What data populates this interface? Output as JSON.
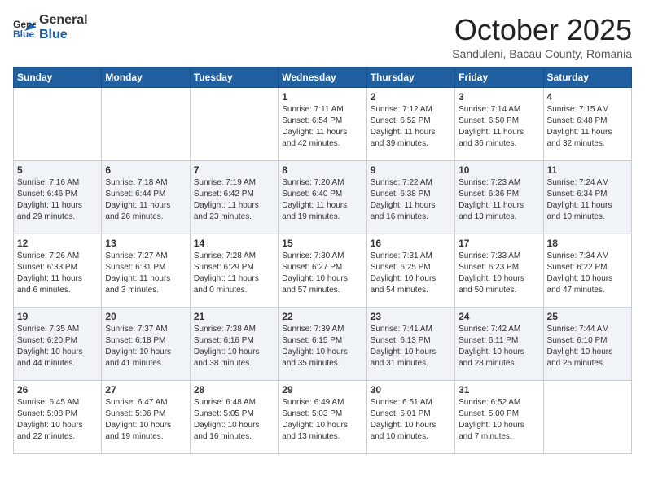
{
  "header": {
    "logo_general": "General",
    "logo_blue": "Blue",
    "month_title": "October 2025",
    "subtitle": "Sanduleni, Bacau County, Romania"
  },
  "weekdays": [
    "Sunday",
    "Monday",
    "Tuesday",
    "Wednesday",
    "Thursday",
    "Friday",
    "Saturday"
  ],
  "weeks": [
    [
      {
        "day": "",
        "info": ""
      },
      {
        "day": "",
        "info": ""
      },
      {
        "day": "",
        "info": ""
      },
      {
        "day": "1",
        "info": "Sunrise: 7:11 AM\nSunset: 6:54 PM\nDaylight: 11 hours\nand 42 minutes."
      },
      {
        "day": "2",
        "info": "Sunrise: 7:12 AM\nSunset: 6:52 PM\nDaylight: 11 hours\nand 39 minutes."
      },
      {
        "day": "3",
        "info": "Sunrise: 7:14 AM\nSunset: 6:50 PM\nDaylight: 11 hours\nand 36 minutes."
      },
      {
        "day": "4",
        "info": "Sunrise: 7:15 AM\nSunset: 6:48 PM\nDaylight: 11 hours\nand 32 minutes."
      }
    ],
    [
      {
        "day": "5",
        "info": "Sunrise: 7:16 AM\nSunset: 6:46 PM\nDaylight: 11 hours\nand 29 minutes."
      },
      {
        "day": "6",
        "info": "Sunrise: 7:18 AM\nSunset: 6:44 PM\nDaylight: 11 hours\nand 26 minutes."
      },
      {
        "day": "7",
        "info": "Sunrise: 7:19 AM\nSunset: 6:42 PM\nDaylight: 11 hours\nand 23 minutes."
      },
      {
        "day": "8",
        "info": "Sunrise: 7:20 AM\nSunset: 6:40 PM\nDaylight: 11 hours\nand 19 minutes."
      },
      {
        "day": "9",
        "info": "Sunrise: 7:22 AM\nSunset: 6:38 PM\nDaylight: 11 hours\nand 16 minutes."
      },
      {
        "day": "10",
        "info": "Sunrise: 7:23 AM\nSunset: 6:36 PM\nDaylight: 11 hours\nand 13 minutes."
      },
      {
        "day": "11",
        "info": "Sunrise: 7:24 AM\nSunset: 6:34 PM\nDaylight: 11 hours\nand 10 minutes."
      }
    ],
    [
      {
        "day": "12",
        "info": "Sunrise: 7:26 AM\nSunset: 6:33 PM\nDaylight: 11 hours\nand 6 minutes."
      },
      {
        "day": "13",
        "info": "Sunrise: 7:27 AM\nSunset: 6:31 PM\nDaylight: 11 hours\nand 3 minutes."
      },
      {
        "day": "14",
        "info": "Sunrise: 7:28 AM\nSunset: 6:29 PM\nDaylight: 11 hours\nand 0 minutes."
      },
      {
        "day": "15",
        "info": "Sunrise: 7:30 AM\nSunset: 6:27 PM\nDaylight: 10 hours\nand 57 minutes."
      },
      {
        "day": "16",
        "info": "Sunrise: 7:31 AM\nSunset: 6:25 PM\nDaylight: 10 hours\nand 54 minutes."
      },
      {
        "day": "17",
        "info": "Sunrise: 7:33 AM\nSunset: 6:23 PM\nDaylight: 10 hours\nand 50 minutes."
      },
      {
        "day": "18",
        "info": "Sunrise: 7:34 AM\nSunset: 6:22 PM\nDaylight: 10 hours\nand 47 minutes."
      }
    ],
    [
      {
        "day": "19",
        "info": "Sunrise: 7:35 AM\nSunset: 6:20 PM\nDaylight: 10 hours\nand 44 minutes."
      },
      {
        "day": "20",
        "info": "Sunrise: 7:37 AM\nSunset: 6:18 PM\nDaylight: 10 hours\nand 41 minutes."
      },
      {
        "day": "21",
        "info": "Sunrise: 7:38 AM\nSunset: 6:16 PM\nDaylight: 10 hours\nand 38 minutes."
      },
      {
        "day": "22",
        "info": "Sunrise: 7:39 AM\nSunset: 6:15 PM\nDaylight: 10 hours\nand 35 minutes."
      },
      {
        "day": "23",
        "info": "Sunrise: 7:41 AM\nSunset: 6:13 PM\nDaylight: 10 hours\nand 31 minutes."
      },
      {
        "day": "24",
        "info": "Sunrise: 7:42 AM\nSunset: 6:11 PM\nDaylight: 10 hours\nand 28 minutes."
      },
      {
        "day": "25",
        "info": "Sunrise: 7:44 AM\nSunset: 6:10 PM\nDaylight: 10 hours\nand 25 minutes."
      }
    ],
    [
      {
        "day": "26",
        "info": "Sunrise: 6:45 AM\nSunset: 5:08 PM\nDaylight: 10 hours\nand 22 minutes."
      },
      {
        "day": "27",
        "info": "Sunrise: 6:47 AM\nSunset: 5:06 PM\nDaylight: 10 hours\nand 19 minutes."
      },
      {
        "day": "28",
        "info": "Sunrise: 6:48 AM\nSunset: 5:05 PM\nDaylight: 10 hours\nand 16 minutes."
      },
      {
        "day": "29",
        "info": "Sunrise: 6:49 AM\nSunset: 5:03 PM\nDaylight: 10 hours\nand 13 minutes."
      },
      {
        "day": "30",
        "info": "Sunrise: 6:51 AM\nSunset: 5:01 PM\nDaylight: 10 hours\nand 10 minutes."
      },
      {
        "day": "31",
        "info": "Sunrise: 6:52 AM\nSunset: 5:00 PM\nDaylight: 10 hours\nand 7 minutes."
      },
      {
        "day": "",
        "info": ""
      }
    ]
  ]
}
